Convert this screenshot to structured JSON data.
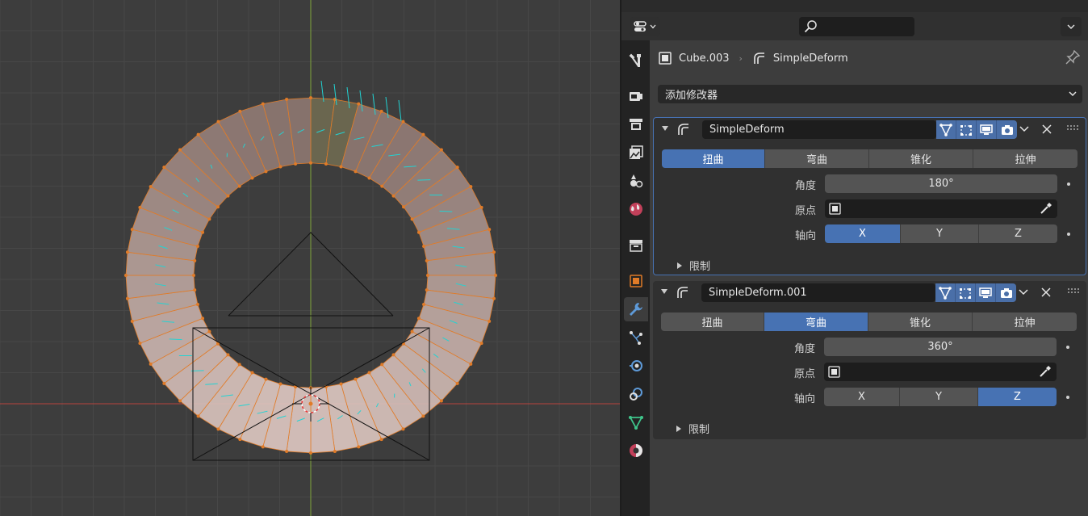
{
  "viewport": {
    "name": "3d-viewport"
  },
  "header": {
    "editor_type_icon": "properties-editor-icon",
    "search": {
      "placeholder": "",
      "icon": "search-icon"
    }
  },
  "tabs": [
    {
      "name": "tool",
      "icon": "wrench-screwdriver-icon",
      "active": false
    },
    {
      "name": "render",
      "icon": "camera-back-icon",
      "active": false
    },
    {
      "name": "output",
      "icon": "printer-icon",
      "active": false
    },
    {
      "name": "view-layer",
      "icon": "image-stack-icon",
      "active": false
    },
    {
      "name": "scene",
      "icon": "scene-icon",
      "active": false
    },
    {
      "name": "world",
      "icon": "globe-icon",
      "active": false
    },
    {
      "name": "collection",
      "icon": "box-icon",
      "active": false
    },
    {
      "name": "object",
      "icon": "orange-square-icon",
      "active": false
    },
    {
      "name": "modifiers",
      "icon": "wrench-icon",
      "active": true
    },
    {
      "name": "particles",
      "icon": "particles-icon",
      "active": false
    },
    {
      "name": "physics",
      "icon": "physics-icon",
      "active": false
    },
    {
      "name": "constraints",
      "icon": "constraint-icon",
      "active": false
    },
    {
      "name": "data",
      "icon": "mesh-triangle-icon",
      "active": false
    },
    {
      "name": "material",
      "icon": "material-sphere-icon",
      "active": false
    }
  ],
  "breadcrumb": {
    "object": "Cube.003",
    "modifier": "SimpleDeform"
  },
  "add_modifier": {
    "label": "添加修改器"
  },
  "modifiers": [
    {
      "name": "SimpleDeform",
      "active": true,
      "modes": [
        "扭曲",
        "弯曲",
        "锥化",
        "拉伸"
      ],
      "selected_mode": "扭曲",
      "angle_label": "角度",
      "angle": "180°",
      "origin_label": "原点",
      "axis_label": "轴向",
      "axes": [
        "X",
        "Y",
        "Z"
      ],
      "selected_axis": "X",
      "restrictions_label": "限制"
    },
    {
      "name": "SimpleDeform.001",
      "active": false,
      "modes": [
        "扭曲",
        "弯曲",
        "锥化",
        "拉伸"
      ],
      "selected_mode": "弯曲",
      "angle_label": "角度",
      "angle": "360°",
      "origin_label": "原点",
      "axis_label": "轴向",
      "axes": [
        "X",
        "Y",
        "Z"
      ],
      "selected_axis": "Z",
      "restrictions_label": "限制"
    }
  ],
  "colors": {
    "accent": "#4772b3",
    "selection_orange": "#e07b28",
    "normals": "#22d3d3",
    "x_axis": "#b8443d",
    "y_axis": "#7ea53a"
  }
}
